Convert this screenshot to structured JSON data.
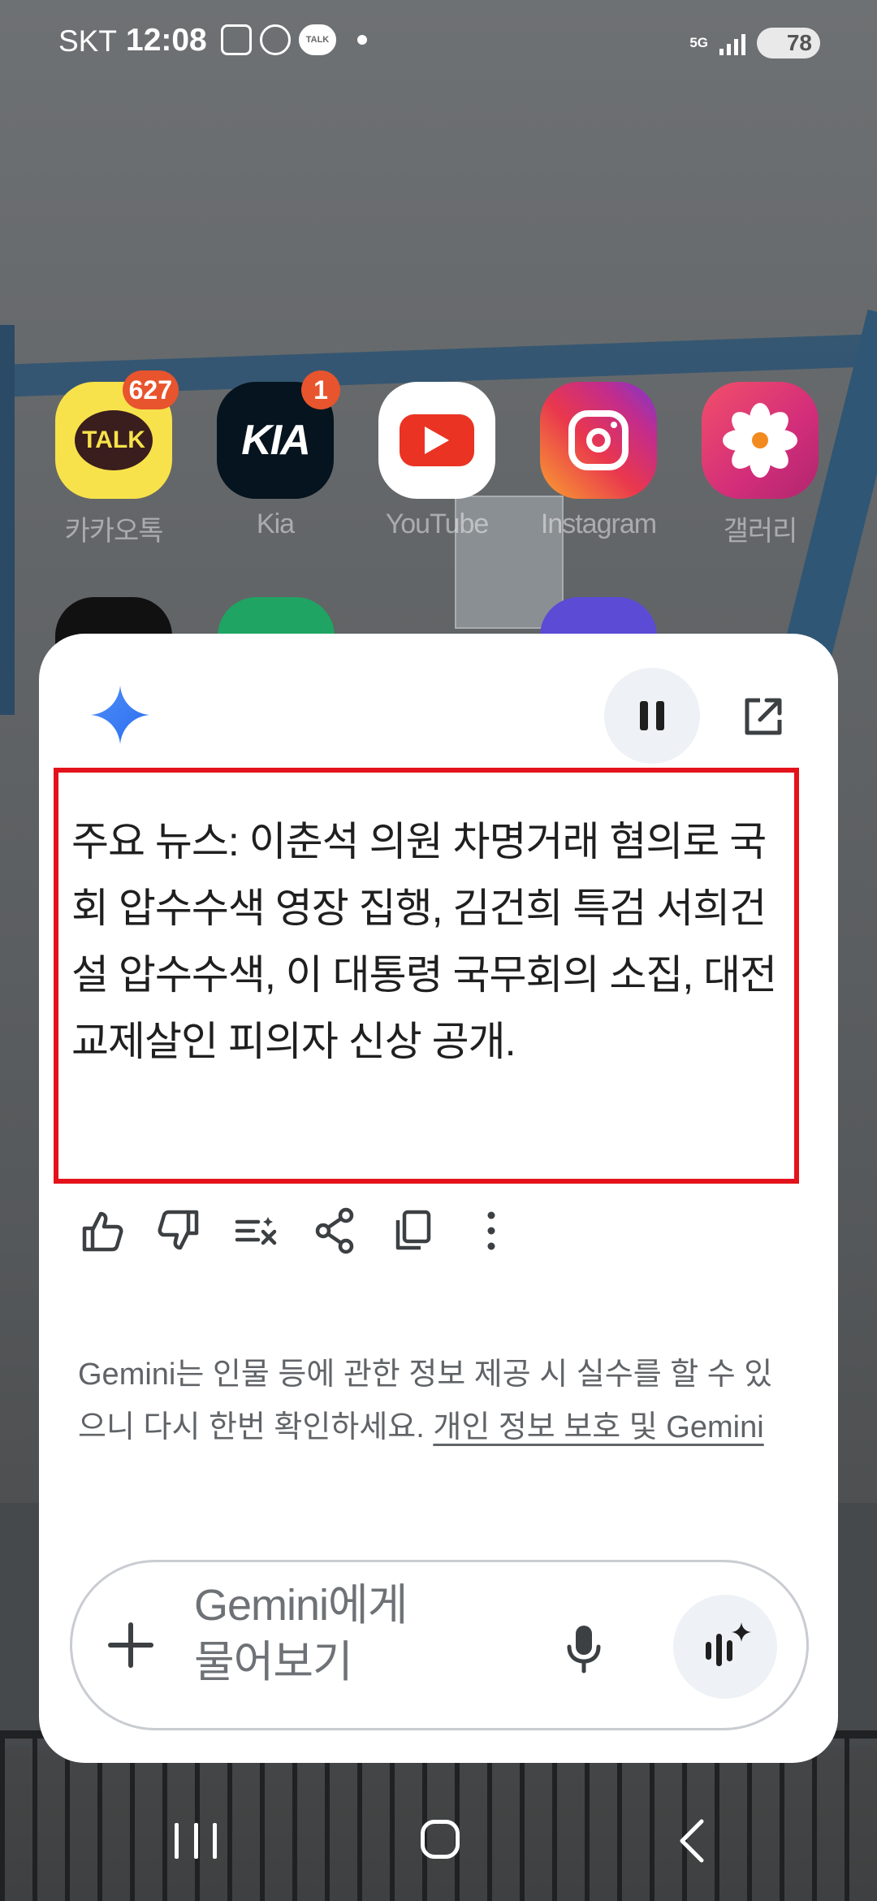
{
  "status_bar": {
    "carrier": "SKT",
    "time": "12:08",
    "network": "5G",
    "battery": "78",
    "notification_icons": [
      "screenshot-icon",
      "location-face-icon",
      "kakaotalk-icon",
      "dot-icon"
    ]
  },
  "apps": [
    {
      "label": "카카오톡",
      "badge": "627",
      "icon": "kakaotalk-icon",
      "color": "#f7e24b"
    },
    {
      "label": "Kia",
      "badge": "1",
      "icon": "kia-icon",
      "color": "#05141f"
    },
    {
      "label": "YouTube",
      "badge": "",
      "icon": "youtube-icon",
      "color": "#ffffff"
    },
    {
      "label": "Instagram",
      "badge": "",
      "icon": "instagram-icon",
      "color": "#d62976"
    },
    {
      "label": "갤러리",
      "badge": "",
      "icon": "gallery-icon",
      "color": "#d22d7a"
    }
  ],
  "app_icons": {
    "talk_text": "TALK",
    "kia_text": "KIA"
  },
  "gemini": {
    "response": "주요 뉴스: 이춘석 의원 차명거래 혐의로 국회 압수수색 영장 집행, 김건희 특검 서희건설 압수수색, 이 대통령 국무회의 소집, 대전 교제살인 피의자 신상 공개.",
    "actions": [
      "thumbs-up-icon",
      "thumbs-down-icon",
      "modify-response-icon",
      "share-icon",
      "copy-icon",
      "more-options-icon"
    ],
    "disclaimer": "Gemini는 인물 등에 관한 정보 제공 시 실수를 할 수 있으니 다시 한번 확인하세요.",
    "disclaimer_link": "개인 정보 보호 및 Gemini",
    "input_placeholder": "Gemini에게 물어보기",
    "accent_color": "#4285f4",
    "highlight_color": "#e3121b"
  },
  "navbar": {
    "buttons": [
      "recent-apps-icon",
      "home-icon",
      "back-icon"
    ]
  }
}
